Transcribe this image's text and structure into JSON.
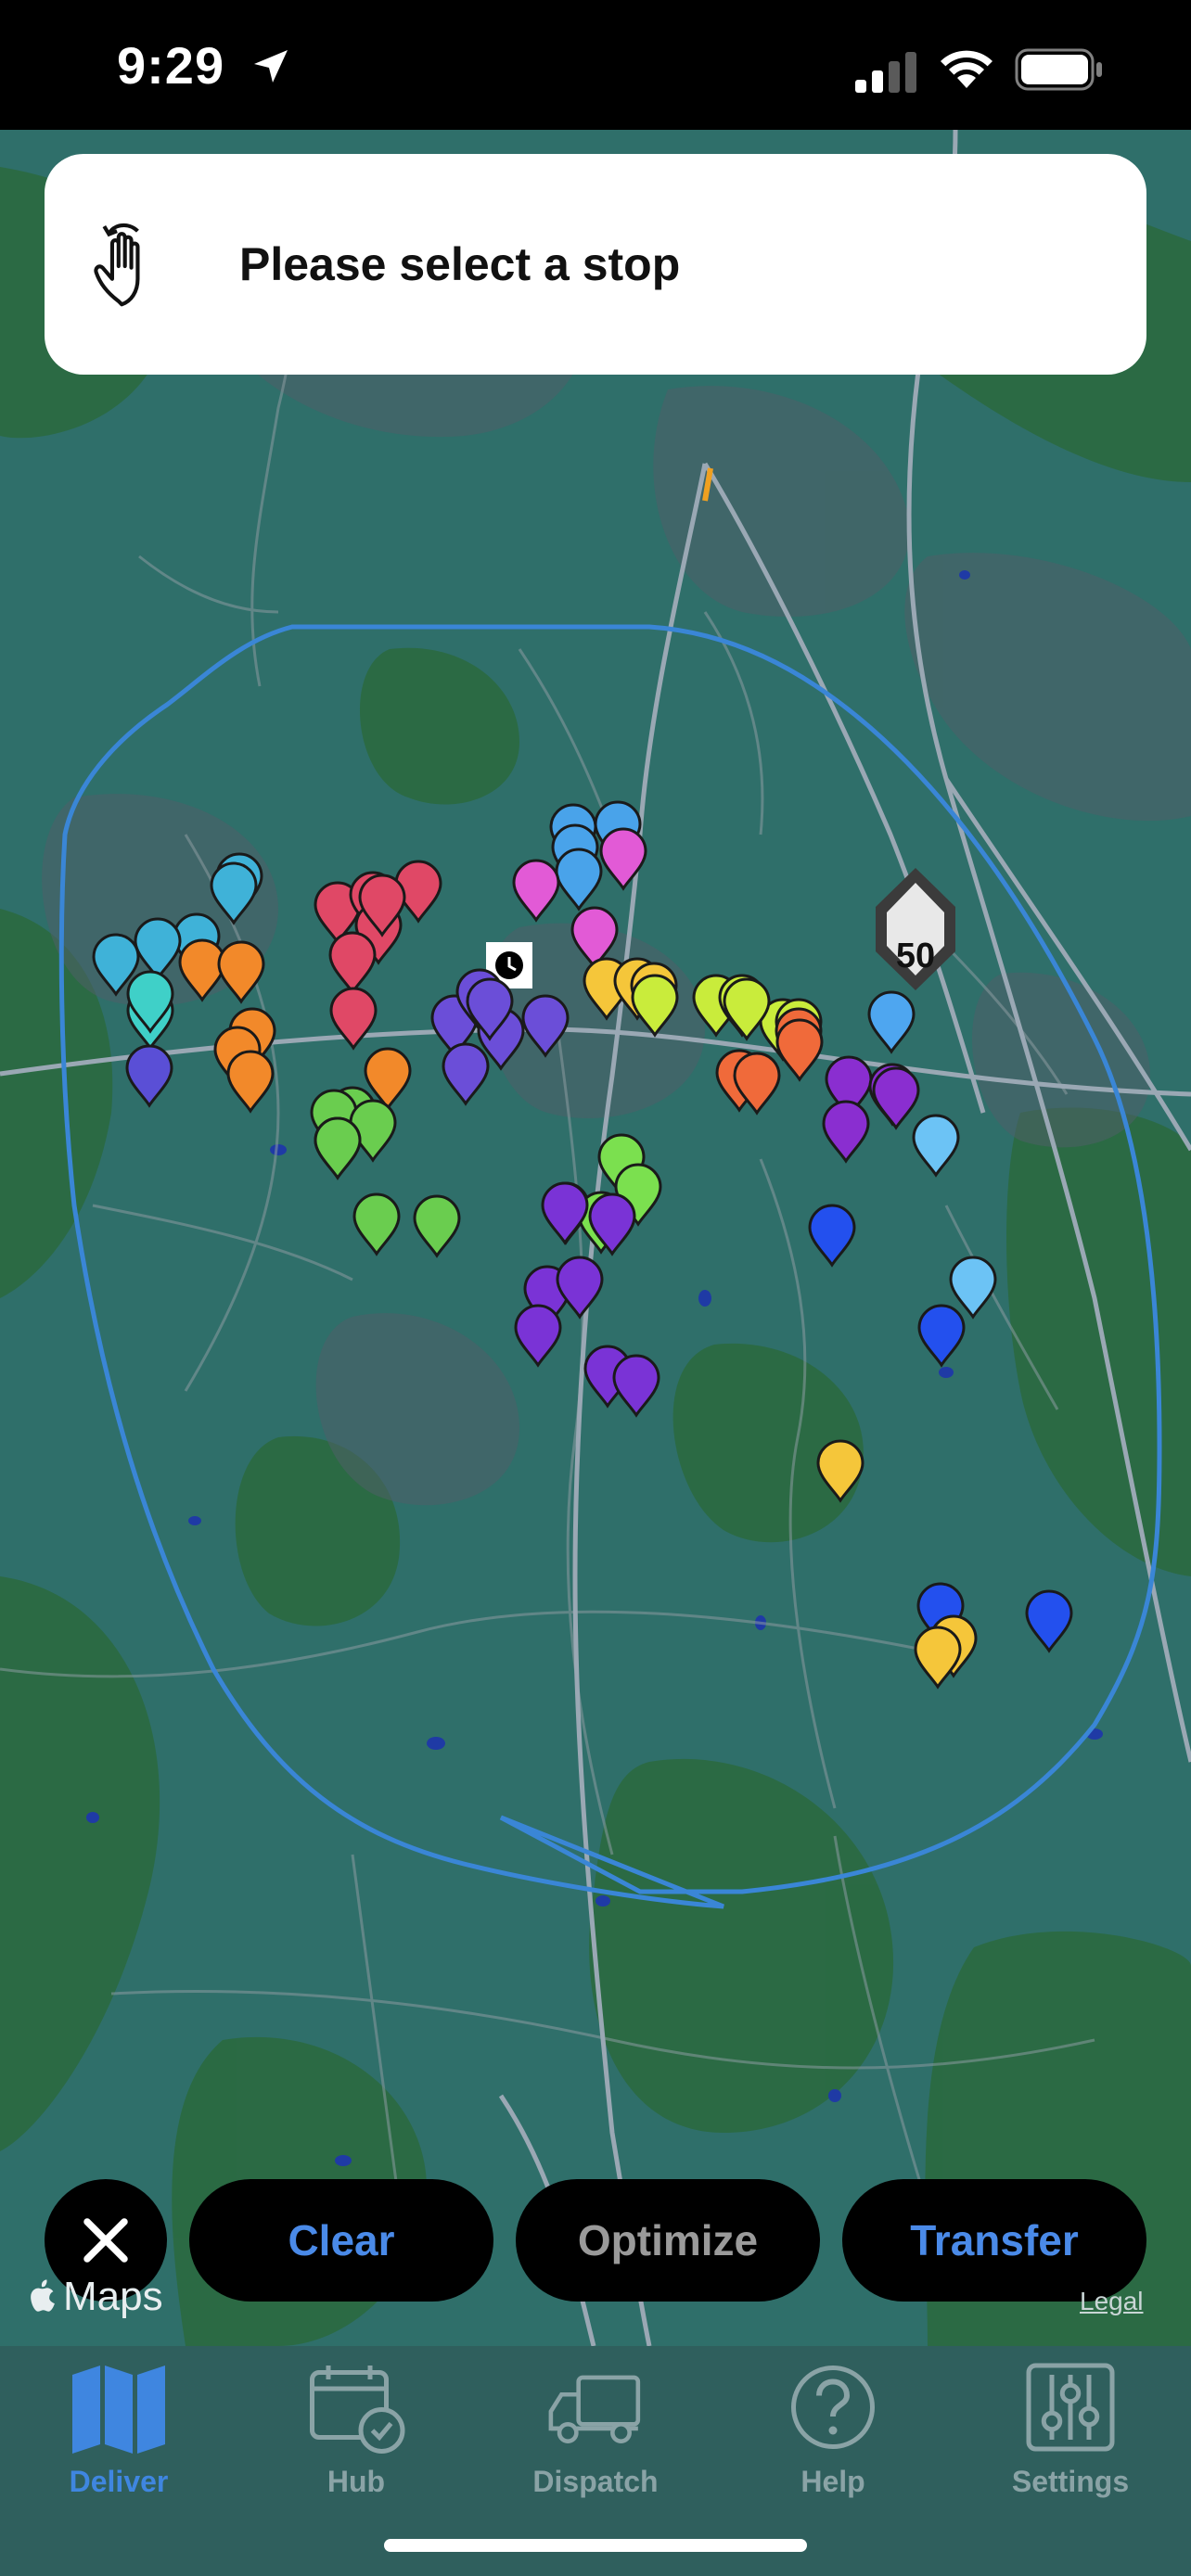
{
  "status_bar": {
    "time": "9:29",
    "icons": [
      "location-arrow-icon",
      "cellular-signal-icon",
      "wifi-icon",
      "battery-icon"
    ]
  },
  "prompt": {
    "text": "Please select a stop",
    "icon": "tap-hand-icon"
  },
  "map": {
    "route_shield": "50",
    "colors": {
      "water_green": "#2f6f6a",
      "boundary": "#3a86d6"
    },
    "stop_pins": [
      {
        "color": "#3fb2d8"
      },
      {
        "color": "#3fb2d8"
      },
      {
        "color": "#3fb2d8"
      },
      {
        "color": "#3fb2d8"
      },
      {
        "color": "#3fb2d8"
      },
      {
        "color": "#3fd0c8"
      },
      {
        "color": "#3fd0c8"
      },
      {
        "color": "#f2892a"
      },
      {
        "color": "#f2892a"
      },
      {
        "color": "#f2892a"
      },
      {
        "color": "#f2892a"
      },
      {
        "color": "#f2892a"
      },
      {
        "color": "#f2892a"
      },
      {
        "color": "#5a4fd6"
      },
      {
        "color": "#e04866"
      },
      {
        "color": "#e04866"
      },
      {
        "color": "#e04866"
      },
      {
        "color": "#e04866"
      },
      {
        "color": "#e04866"
      },
      {
        "color": "#e04866"
      },
      {
        "color": "#e04866"
      },
      {
        "color": "#6b4ed8"
      },
      {
        "color": "#6b4ed8"
      },
      {
        "color": "#6b4ed8"
      },
      {
        "color": "#6b4ed8"
      },
      {
        "color": "#6b4ed8"
      },
      {
        "color": "#6b4ed8"
      },
      {
        "color": "#49a3ea"
      },
      {
        "color": "#49a3ea"
      },
      {
        "color": "#49a3ea"
      },
      {
        "color": "#49a3ea"
      },
      {
        "color": "#e25ad6"
      },
      {
        "color": "#e25ad6"
      },
      {
        "color": "#e25ad6"
      },
      {
        "color": "#f5c63a"
      },
      {
        "color": "#f5c63a"
      },
      {
        "color": "#f5c63a"
      },
      {
        "color": "#c9ec3b"
      },
      {
        "color": "#c9ec3b"
      },
      {
        "color": "#c9ec3b"
      },
      {
        "color": "#c9ec3b"
      },
      {
        "color": "#c9ec3b"
      },
      {
        "color": "#c9ec3b"
      },
      {
        "color": "#f06a3a"
      },
      {
        "color": "#f06a3a"
      },
      {
        "color": "#f06a3a"
      },
      {
        "color": "#f06a3a"
      },
      {
        "color": "#8a2ed0"
      },
      {
        "color": "#8a2ed0"
      },
      {
        "color": "#8a2ed0"
      },
      {
        "color": "#8a2ed0"
      },
      {
        "color": "#4ea6f0"
      },
      {
        "color": "#6cc3f5"
      },
      {
        "color": "#6cc3f5"
      },
      {
        "color": "#2350ee"
      },
      {
        "color": "#2350ee"
      },
      {
        "color": "#2350ee"
      },
      {
        "color": "#2350ee"
      },
      {
        "color": "#6acd4f"
      },
      {
        "color": "#6acd4f"
      },
      {
        "color": "#6acd4f"
      },
      {
        "color": "#6acd4f"
      },
      {
        "color": "#6acd4f"
      },
      {
        "color": "#6acd4f"
      },
      {
        "color": "#6acd4f"
      },
      {
        "color": "#7be04f"
      },
      {
        "color": "#7be04f"
      },
      {
        "color": "#7be04f"
      },
      {
        "color": "#7be04f"
      },
      {
        "color": "#7a33d6"
      },
      {
        "color": "#7a33d6"
      },
      {
        "color": "#7a33d6"
      },
      {
        "color": "#7a33d6"
      },
      {
        "color": "#7a33d6"
      },
      {
        "color": "#7a33d6"
      },
      {
        "color": "#7a33d6"
      },
      {
        "color": "#f5c63a"
      },
      {
        "color": "#f5c63a"
      },
      {
        "color": "#f5c63a"
      }
    ],
    "attribution": "Maps",
    "legal": "Legal"
  },
  "actions": {
    "close_icon": "close-icon",
    "clear": "Clear",
    "optimize": "Optimize",
    "transfer": "Transfer"
  },
  "tabs": [
    {
      "label": "Deliver",
      "icon": "map-icon",
      "active": true
    },
    {
      "label": "Hub",
      "icon": "calendar-check-icon",
      "active": false
    },
    {
      "label": "Dispatch",
      "icon": "truck-icon",
      "active": false
    },
    {
      "label": "Help",
      "icon": "question-icon",
      "active": false
    },
    {
      "label": "Settings",
      "icon": "sliders-icon",
      "active": false
    }
  ],
  "colors": {
    "accent": "#3f86e0",
    "inactive": "#8aa3a6",
    "tab_bg": "#2f5f5d"
  }
}
